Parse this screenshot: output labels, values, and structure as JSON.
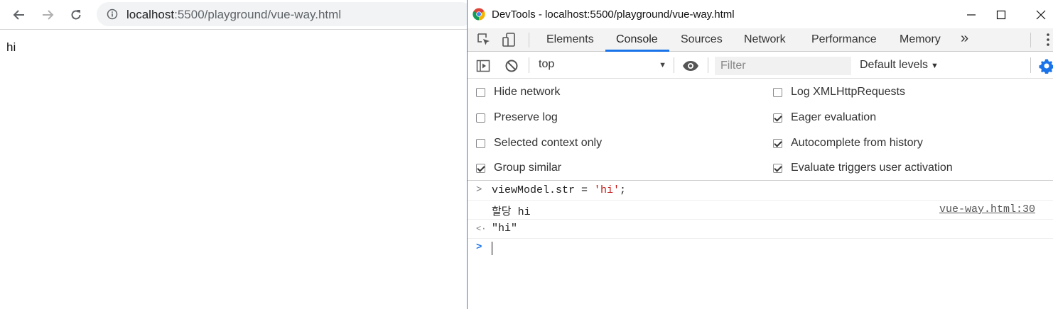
{
  "browser": {
    "url_host": "localhost",
    "url_path": ":5500/playground/vue-way.html",
    "page_text": "hi"
  },
  "devtools": {
    "title": "DevTools - localhost:5500/playground/vue-way.html",
    "tabs": [
      {
        "label": "Elements",
        "active": false
      },
      {
        "label": "Console",
        "active": true
      },
      {
        "label": "Sources",
        "active": false
      },
      {
        "label": "Network",
        "active": false
      },
      {
        "label": "Performance",
        "active": false
      },
      {
        "label": "Memory",
        "active": false
      }
    ],
    "more_tabs_glyph": "»",
    "context": "top",
    "filter_placeholder": "Filter",
    "levels_label": "Default levels",
    "settings": {
      "left": [
        {
          "label": "Hide network",
          "checked": false
        },
        {
          "label": "Preserve log",
          "checked": false
        },
        {
          "label": "Selected context only",
          "checked": false
        },
        {
          "label": "Group similar",
          "checked": true
        }
      ],
      "right": [
        {
          "label": "Log XMLHttpRequests",
          "checked": false
        },
        {
          "label": "Eager evaluation",
          "checked": true
        },
        {
          "label": "Autocomplete from history",
          "checked": true
        },
        {
          "label": "Evaluate triggers user activation",
          "checked": true
        }
      ]
    },
    "console": {
      "input_code_prefix": "viewModel.str = ",
      "input_code_string": "'hi'",
      "input_code_suffix": ";",
      "log_text": "할당 hi",
      "log_source": "vue-way.html:30",
      "result_text": "\"hi\"",
      "input_glyph": ">",
      "result_glyph": "<·",
      "prompt_glyph": ">"
    }
  },
  "colors": {
    "accent": "#1a73e8",
    "string": "#c41a16",
    "devtools_border": "#3d7fd0"
  },
  "icons": [
    "back-arrow-icon",
    "forward-arrow-icon",
    "reload-icon",
    "info-icon",
    "chrome-logo-icon",
    "minimize-icon",
    "maximize-icon",
    "close-icon",
    "inspect-icon",
    "device-toolbar-icon",
    "kebab-menu-icon",
    "sidebar-toggle-icon",
    "clear-console-icon",
    "eye-icon",
    "gear-icon"
  ]
}
